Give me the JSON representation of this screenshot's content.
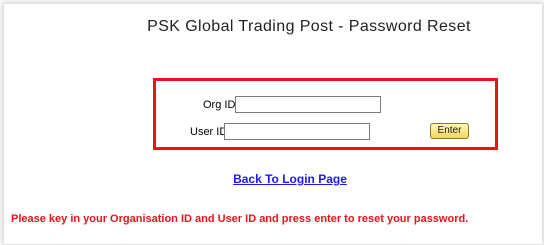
{
  "page": {
    "title": "PSK Global Trading Post - Password Reset"
  },
  "form": {
    "org_id_label": "Org ID:",
    "org_id_value": "",
    "user_id_label": "User ID:",
    "user_id_value": "",
    "enter_label": "Enter"
  },
  "links": {
    "back_to_login": "Back To Login Page"
  },
  "message": {
    "instruction": "Please key in your Organisation ID and User ID and press enter to reset your password."
  },
  "colors": {
    "highlight_border": "#e8141b",
    "link": "#1a1aee",
    "message": "#e8141b",
    "button_fill": "#f2d65a"
  }
}
